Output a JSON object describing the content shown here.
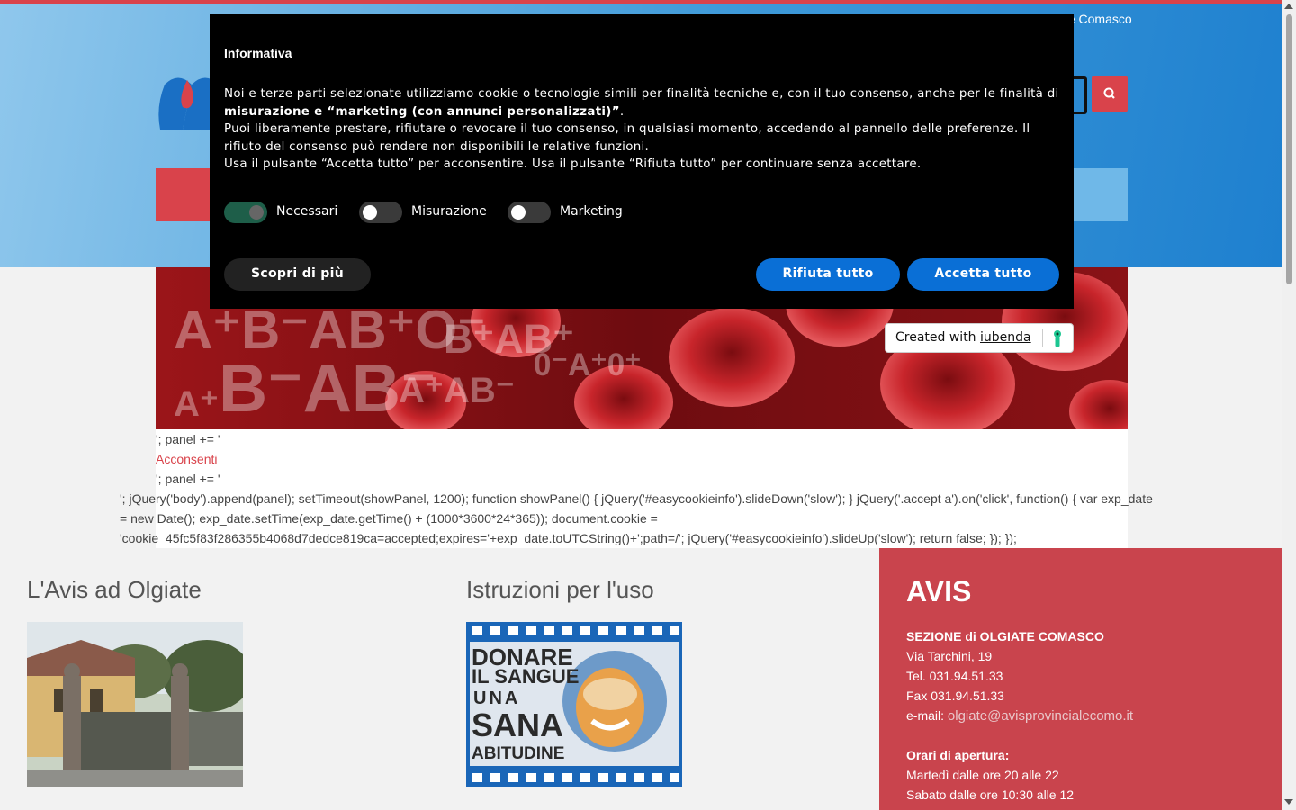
{
  "header": {
    "section_name": "Sezione di Olgiate Comasco"
  },
  "cookie_banner": {
    "title": "Informativa",
    "text_line1": "Noi e terze parti selezionate utilizziamo cookie o tecnologie simili per finalità tecniche e, con il tuo consenso, anche per le finalità di",
    "text_bold": "misurazione e “marketing (con annunci personalizzati)”",
    "text_line2": "Puoi liberamente prestare, rifiutare o revocare il tuo consenso, in qualsiasi momento, accedendo al pannello delle preferenze. Il rifiuto del consenso può rendere non disponibili le relative funzioni.",
    "text_line3": "Usa il pulsante “Accetta tutto” per acconsentire. Usa il pulsante “Rifiuta tutto” per continuare senza accettare.",
    "toggles": [
      {
        "label": "Necessari",
        "on": true
      },
      {
        "label": "Misurazione",
        "on": false
      },
      {
        "label": "Marketing",
        "on": false
      }
    ],
    "learn_more": "Scopri di più",
    "reject_all": "Rifiuta tutto",
    "accept_all": "Accetta tutto",
    "created_with": "Created with",
    "iubenda": "iubenda"
  },
  "code_text": {
    "line1": "'; panel += '",
    "link": "Acconsenti",
    "line3": "'; panel += '",
    "line4": "'; jQuery('body').append(panel); setTimeout(showPanel, 1200); function showPanel() { jQuery('#easycookieinfo').slideDown('slow'); } jQuery('.accept a').on('click', function() { var exp_date",
    "line5": "= new Date(); exp_date.setTime(exp_date.getTime() + (1000*3600*24*365)); document.cookie =",
    "line6": "'cookie_45fc5f83f286355b4068d7dedce819ca=accepted;expires='+exp_date.toUTCString()+';path=/'; jQuery('#easycookieinfo').slideUp('slow'); return false; }); });"
  },
  "columns": {
    "left_title": "L'Avis ad Olgiate",
    "middle_title": "Istruzioni per l'uso"
  },
  "avis": {
    "title": "AVIS",
    "section": "SEZIONE di OLGIATE COMASCO",
    "address": "Via Tarchini, 19",
    "tel": "Tel. 031.94.51.33",
    "fax": "Fax 031.94.51.33",
    "email_label": "e-mail:",
    "email": "olgiate@avisprovincialecomo.it",
    "hours_title": "Orari di apertura:",
    "hours1": "Martedì dalle ore 20 alle 22",
    "hours2": "Sabato dalle ore 10:30 alle 12"
  },
  "poster": {
    "l1": "DONARE",
    "l2": "IL SANGUE",
    "l3": "UNA",
    "l4": "SANA",
    "l5": "ABITUDINE"
  },
  "colors": {
    "accent_red": "#d9434b",
    "button_blue": "#0a6fd6",
    "toggle_on": "#1e5e49"
  }
}
